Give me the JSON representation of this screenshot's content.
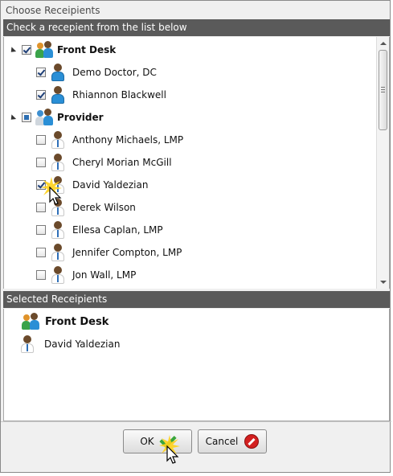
{
  "window": {
    "title": "Choose Receipients"
  },
  "list_header": "Check a recepient from the list below",
  "groups": [
    {
      "name": "Front Desk",
      "state": "checked",
      "members": [
        {
          "name": "Demo Doctor, DC",
          "checked": true
        },
        {
          "name": "Rhiannon Blackwell",
          "checked": true
        }
      ]
    },
    {
      "name": "Provider",
      "state": "partial",
      "members": [
        {
          "name": "Anthony Michaels, LMP",
          "checked": false
        },
        {
          "name": "Cheryl Morian McGill",
          "checked": false
        },
        {
          "name": "David Yaldezian",
          "checked": true
        },
        {
          "name": "Derek Wilson",
          "checked": false
        },
        {
          "name": "Ellesa Caplan, LMP",
          "checked": false
        },
        {
          "name": "Jennifer Compton, LMP",
          "checked": false
        },
        {
          "name": "Jon Wall, LMP",
          "checked": false
        }
      ]
    }
  ],
  "selected_header": "Selected Receipients",
  "selected": [
    {
      "name": "Front Desk",
      "type": "group"
    },
    {
      "name": "David Yaldezian",
      "type": "person"
    }
  ],
  "buttons": {
    "ok": "OK",
    "cancel": "Cancel"
  },
  "icons": {
    "group": "users-group-icon",
    "person": "person-icon",
    "ok": "checkmark-icon",
    "cancel": "no-entry-icon"
  }
}
